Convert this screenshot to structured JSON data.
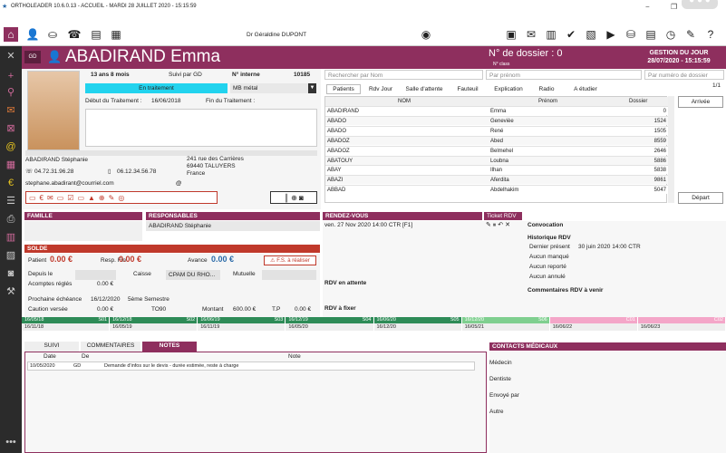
{
  "window": {
    "title": "ORTHOLEADER 10.6.0.13 - ACCUEIL - MARDI 28 JUILLET 2020 - 15:15:59",
    "doctor": "Dr Géraldine DUPONT"
  },
  "patient": {
    "initials": "GD",
    "name": "ABADIRAND Emma",
    "age": "13 ans 8 mois",
    "suivi": "Suivi par GD",
    "interne_label": "N° interne",
    "interne": "10185",
    "status": "En traitement",
    "appareil": "MB métal",
    "debut_label": "Début du Traitement :",
    "debut": "16/06/2018",
    "fin_label": "Fin du Traitement :"
  },
  "header": {
    "dossier": "N° de dossier : 0",
    "classe": "N° class",
    "gestion_title": "GESTION DU JOUR",
    "gestion_date": "28/07/2020 - 15:15:59"
  },
  "contact": {
    "responsable": "ABADIRAND Stéphanie",
    "phone1": "04.72.31.96.28",
    "phone2": "06.12.34.56.78",
    "email": "stephane.abadirant@courriel.com",
    "address1": "241 rue des Carrières",
    "address2": "69440 TALUYERS",
    "country": "France"
  },
  "search": {
    "name_placeholder": "Rechercher par Nom",
    "prenom_placeholder": "Par prénom",
    "dossier_placeholder": "Par numéro de dossier",
    "page": "1/1"
  },
  "list_tabs": [
    "Patients",
    "Rdv Jour",
    "Salle d'attente",
    "Fauteuil",
    "Explication",
    "Radio",
    "A étudier"
  ],
  "list_headers": {
    "nom": "NOM",
    "prenom": "Prénom",
    "dossier": "Dossier"
  },
  "list_rows": [
    {
      "nom": "ABADIRAND",
      "prenom": "Emma",
      "dossier": "0"
    },
    {
      "nom": "ABADO",
      "prenom": "Genevièe",
      "dossier": "1524"
    },
    {
      "nom": "ABADO",
      "prenom": "René",
      "dossier": "1505"
    },
    {
      "nom": "ABADOZ",
      "prenom": "Abed",
      "dossier": "8559"
    },
    {
      "nom": "ABADOZ",
      "prenom": "Belmehel",
      "dossier": "2646"
    },
    {
      "nom": "ABATOUY",
      "prenom": "Loubna",
      "dossier": "5886"
    },
    {
      "nom": "ABAY",
      "prenom": "Ilhan",
      "dossier": "5838"
    },
    {
      "nom": "ABAZI",
      "prenom": "Aferdita",
      "dossier": "9861"
    },
    {
      "nom": "ABBAD",
      "prenom": "Abdelhakim",
      "dossier": "5047"
    }
  ],
  "side_buttons": {
    "arrivee": "Arrivée",
    "depart": "Départ"
  },
  "famille": {
    "title": "FAMILLE"
  },
  "responsables": {
    "title": "RESPONSABLES",
    "item": "ABADIRAND Stéphanie"
  },
  "solde": {
    "title": "SOLDE",
    "patient_label": "Patient",
    "patient": "0.00 €",
    "resp_label": "Resp. Fin",
    "resp": "0.00 €",
    "avance_label": "Avance",
    "avance": "0.00 €",
    "fs": "F.S. à réaliser",
    "depuis": "Depuis le",
    "caisse": "Caisse",
    "caisse_val": "CPAM DU RHO...",
    "mutuelle": "Mutuelle",
    "acomptes": "Acomptes réglés",
    "acomptes_val": "0.00 €",
    "prochaine": "Prochaine échéance",
    "prochaine_date": "16/12/2020",
    "semestre": "5ème Semestre",
    "caution": "Caution versée",
    "caution_val": "0.00 €",
    "to": "TO90",
    "montant": "Montant",
    "montant_val": "600.00 €",
    "tp": "T.P",
    "tp_val": "0.00 €"
  },
  "rdv": {
    "title": "RENDEZ-VOUS",
    "ticket": "Ticket RDV",
    "item": "ven. 27 Nov 2020 14:00 CTR [F1]",
    "attente": "RDV en attente",
    "fixer": "RDV à fixer",
    "convocation": "Convocation",
    "historique": "Historique RDV",
    "dernier": "Dernier présent",
    "dernier_val": "30 juin 2020 14:00 CTR",
    "manque": "Aucun manqué",
    "reporte": "Aucun reporté",
    "annule": "Aucun annulé",
    "comment": "Commentaires RDV à venir"
  },
  "timeline": [
    {
      "date": "16/05/18",
      "code": "S01",
      "sub": "16/11/18",
      "color": "#2e8b57"
    },
    {
      "date": "16/12/18",
      "code": "S02",
      "sub": "16/05/19",
      "color": "#2e8b57"
    },
    {
      "date": "16/06/19",
      "code": "S03",
      "sub": "16/11/19",
      "color": "#2e8b57"
    },
    {
      "date": "16/12/19",
      "code": "S04",
      "sub": "16/05/20",
      "color": "#2e8b57"
    },
    {
      "date": "16/06/20",
      "code": "S05",
      "sub": "16/12/20",
      "color": "#2e8b57"
    },
    {
      "date": "16/12/20",
      "code": "S06",
      "sub": "16/05/21",
      "color": "#7fcf8f"
    },
    {
      "date": "",
      "code": "C01",
      "sub": "16/06/22",
      "color": "#f4a6c8"
    },
    {
      "date": "",
      "code": "C02",
      "sub": "16/06/23",
      "color": "#f4a6c8"
    }
  ],
  "notes_tabs": [
    "SUIVI",
    "COMMENTAIRES",
    "NOTES"
  ],
  "notes_headers": {
    "date": "Date",
    "de": "De",
    "note": "Note"
  },
  "notes_row": {
    "date": "10/05/2020",
    "de": "GD",
    "note": "Demande d'infos sur le devis - durée estimée, reste à charge"
  },
  "contacts": {
    "title": "CONTACTS MÉDICAUX",
    "medecin": "Médecin",
    "dentiste": "Dentiste",
    "envoye": "Envoyé par",
    "autre": "Autre"
  }
}
